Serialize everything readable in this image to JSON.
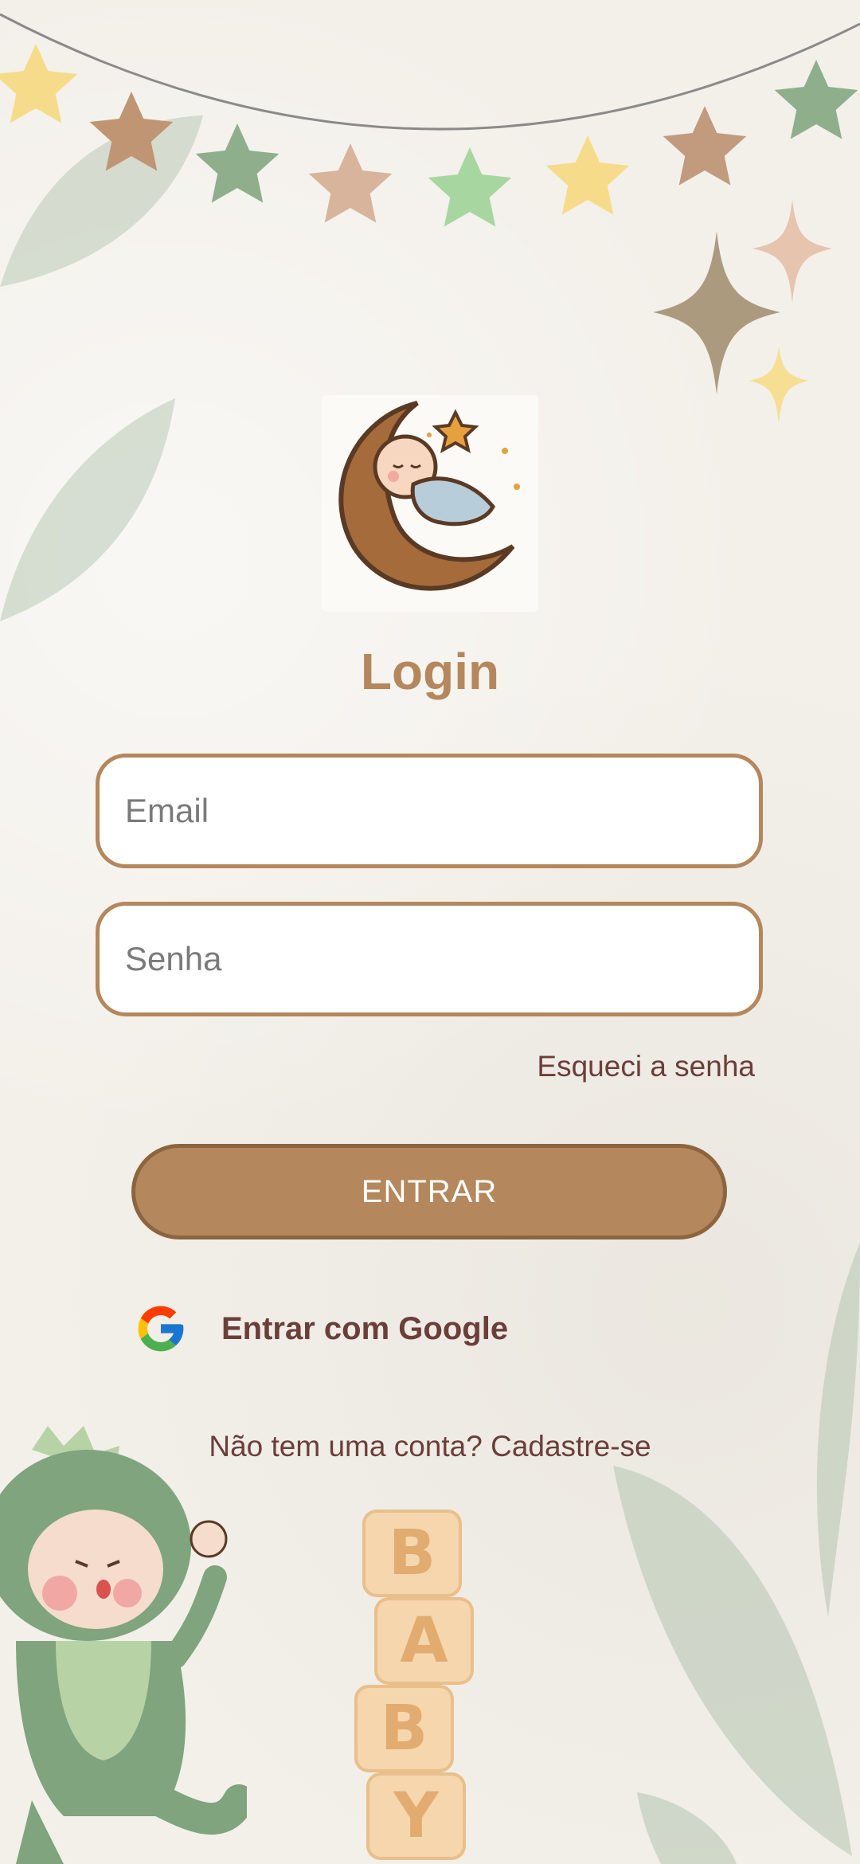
{
  "login": {
    "title": "Login",
    "email_placeholder": "Email",
    "password_placeholder": "Senha",
    "forgot_password": "Esqueci a senha",
    "submit_label": "ENTRAR",
    "google_label": "Entrar com Google",
    "signup_text": "Não tem uma conta? Cadastre-se"
  },
  "decor": {
    "blocks": [
      "B",
      "A",
      "B",
      "Y"
    ],
    "icons": [
      "garland-icon",
      "sparkle-icon",
      "moon-baby-logo",
      "google-icon",
      "baby-dino-illustration",
      "baby-blocks-illustration",
      "leaf-icon"
    ]
  },
  "colors": {
    "accent": "#b5875c",
    "text_dark": "#6b3e3a",
    "background": "#f3f0ea",
    "leaf": "#b9c8b6"
  }
}
